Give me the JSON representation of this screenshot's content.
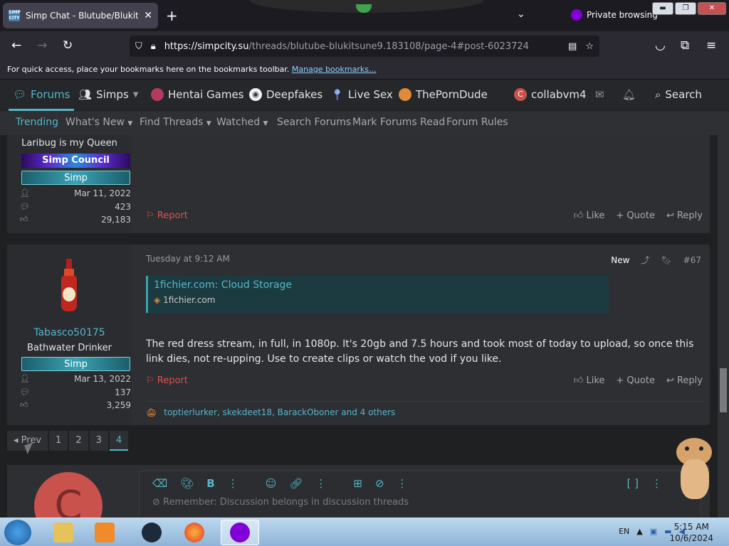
{
  "browser": {
    "tab_title": "Simp Chat - Blutube/Blukitsune",
    "tab_favicon_text": "SIMP CITY",
    "private_label": "Private browsing",
    "url_host": "https://simpcity.su",
    "url_path": "/threads/blutube-blukitsune9.183108/page-4#post-6023724",
    "bookmarks_text": "For quick access, place your bookmarks here on the bookmarks toolbar.",
    "bookmarks_link": "Manage bookmarks..."
  },
  "sitenav": {
    "forums": "Forums",
    "simps": "Simps",
    "hentai": "Hentai Games",
    "deepfakes": "Deepfakes",
    "livesex": "Live Sex",
    "porndude": "ThePornDude",
    "user": "collabvm4",
    "search": "Search"
  },
  "subnav": {
    "trending": "Trending",
    "whats_new": "What's New",
    "find_threads": "Find Threads",
    "watched": "Watched",
    "search_forums": "Search Forums",
    "mark_read": "Mark Forums Read",
    "rules": "Forum Rules"
  },
  "post1": {
    "title": "Laribug is my Queen",
    "banner": "Simp Council",
    "role": "Simp",
    "joined": "Mar 11, 2022",
    "messages": "423",
    "reactions": "29,183",
    "report": "Report",
    "like": "Like",
    "quote": "+ Quote",
    "reply": "Reply"
  },
  "post2": {
    "username": "Tabasco50175",
    "title": "Bathwater Drinker",
    "role": "Simp",
    "joined": "Mar 13, 2022",
    "messages": "137",
    "reactions": "3,259",
    "date": "Tuesday at 9:12 AM",
    "new_label": "New",
    "post_number": "#67",
    "link_title": "1fichier.com: Cloud Storage",
    "link_domain": "1fichier.com",
    "body": "The red dress stream, in full, in 1080p. It's 20gb and 7.5 hours and took most of today to upload, so once this link dies, not re-upping. Use to create clips or watch the vod if you like.",
    "report": "Report",
    "like": "Like",
    "quote": "+ Quote",
    "reply": "Reply",
    "reacted_by": "toptierlurker, skekdeet18, BarackOboner and 4 others"
  },
  "pager": {
    "prev": "Prev",
    "pages": [
      "1",
      "2",
      "3",
      "4"
    ],
    "current": "4"
  },
  "reply": {
    "avatar_letter": "C",
    "placeholder": "Remember: Discussion belongs in discussion threads"
  },
  "taskbar": {
    "lang": "EN",
    "time": "5:15 AM",
    "date": "10/6/2024"
  },
  "colors": {
    "accent": "#55b6c8",
    "report": "#d9534f",
    "post_bg": "#2d2f33"
  }
}
